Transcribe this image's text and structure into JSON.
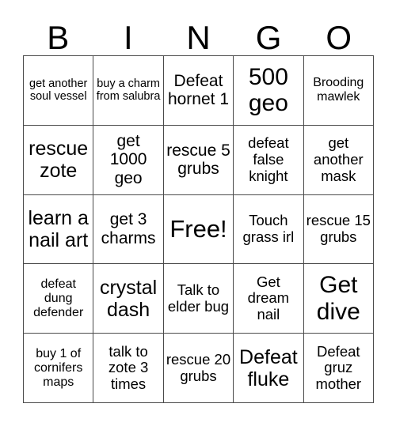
{
  "card": {
    "title": "BINGO",
    "header_letters": [
      "B",
      "I",
      "N",
      "G",
      "O"
    ],
    "colors": {
      "background": "#ffffff",
      "text": "#000000",
      "grid_line": "#4a4a4a"
    },
    "grid_size": "5x5",
    "free_space": {
      "row": 3,
      "column": 3,
      "label": "Free!"
    },
    "rows": [
      [
        {
          "text": "get another soul vessel",
          "size": "xs"
        },
        {
          "text": "buy a charm from salubra",
          "size": "xs"
        },
        {
          "text": "Defeat hornet 1",
          "size": "l"
        },
        {
          "text": "500 geo",
          "size": "xxl"
        },
        {
          "text": "Brooding mawlek",
          "size": "s"
        }
      ],
      [
        {
          "text": "rescue zote",
          "size": "xl"
        },
        {
          "text": "get 1000 geo",
          "size": "l"
        },
        {
          "text": "rescue 5 grubs",
          "size": "l"
        },
        {
          "text": "defeat false knight",
          "size": "m"
        },
        {
          "text": "get another mask",
          "size": "m"
        }
      ],
      [
        {
          "text": "learn a nail art",
          "size": "xl"
        },
        {
          "text": "get 3 charms",
          "size": "l"
        },
        {
          "text": "Free!",
          "size": "free"
        },
        {
          "text": "Touch grass irl",
          "size": "m"
        },
        {
          "text": "rescue 15 grubs",
          "size": "m"
        }
      ],
      [
        {
          "text": "defeat dung defender",
          "size": "s"
        },
        {
          "text": "crystal dash",
          "size": "xl"
        },
        {
          "text": "Talk to elder bug",
          "size": "m"
        },
        {
          "text": "Get dream nail",
          "size": "m"
        },
        {
          "text": "Get dive",
          "size": "xxl"
        }
      ],
      [
        {
          "text": "buy 1 of cornifers maps",
          "size": "s"
        },
        {
          "text": "talk to zote 3 times",
          "size": "m"
        },
        {
          "text": "rescue 20 grubs",
          "size": "m"
        },
        {
          "text": "Defeat fluke",
          "size": "xl"
        },
        {
          "text": "Defeat gruz mother",
          "size": "m"
        }
      ]
    ]
  }
}
